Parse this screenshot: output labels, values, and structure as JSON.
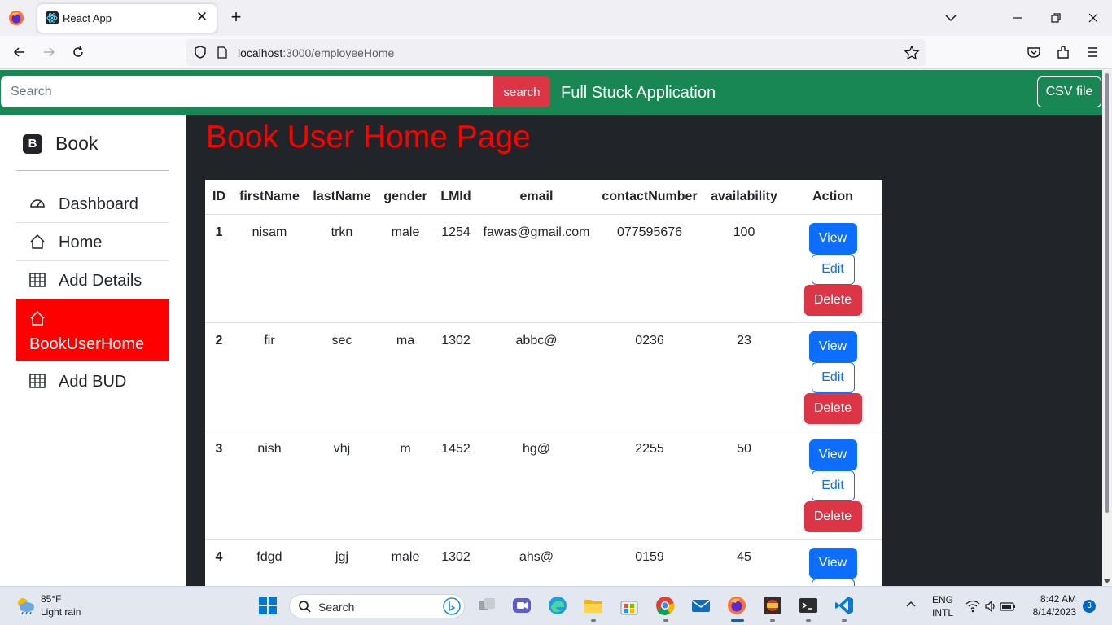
{
  "browser": {
    "tab_title": "React App",
    "url_host": "localhost",
    "url_path": ":3000/employeeHome"
  },
  "header": {
    "search_placeholder": "Search",
    "search_button": "search",
    "brand": "Full Stuck Application",
    "csv_button": "CSV file"
  },
  "sidebar": {
    "brand_letter": "B",
    "brand": "Book",
    "items": [
      {
        "label": "Dashboard",
        "icon": "speedometer-icon"
      },
      {
        "label": "Home",
        "icon": "house-icon"
      },
      {
        "label": "Add Details",
        "icon": "table-icon"
      },
      {
        "label": "BookUserHome",
        "icon": "house-icon",
        "active": true
      },
      {
        "label": "Add BUD",
        "icon": "table-icon"
      }
    ]
  },
  "main": {
    "title": "Book User Home Page",
    "columns": [
      "ID",
      "firstName",
      "lastName",
      "gender",
      "LMId",
      "email",
      "contactNumber",
      "availability",
      "Action"
    ],
    "rows": [
      {
        "id": "1",
        "firstName": "nisam",
        "lastName": "trkn",
        "gender": "male",
        "LMId": "1254",
        "email": "fawas@gmail.com",
        "contactNumber": "077595676",
        "availability": "100"
      },
      {
        "id": "2",
        "firstName": "fir",
        "lastName": "sec",
        "gender": "ma",
        "LMId": "1302",
        "email": "abbc@",
        "contactNumber": "0236",
        "availability": "23"
      },
      {
        "id": "3",
        "firstName": "nish",
        "lastName": "vhj",
        "gender": "m",
        "LMId": "1452",
        "email": "hg@",
        "contactNumber": "2255",
        "availability": "50"
      },
      {
        "id": "4",
        "firstName": "fdgd",
        "lastName": "jgj",
        "gender": "male",
        "LMId": "1302",
        "email": "ahs@",
        "contactNumber": "0159",
        "availability": "45"
      }
    ],
    "actions": {
      "view": "View",
      "edit": "Edit",
      "delete": "Delete"
    }
  },
  "taskbar": {
    "weather_temp": "85°F",
    "weather_desc": "Light rain",
    "search_label": "Search",
    "lang_line1": "ENG",
    "lang_line2": "INTL",
    "time": "8:42 AM",
    "date": "8/14/2023",
    "notification_count": "3"
  },
  "colors": {
    "header_green": "#198754",
    "sidebar_active": "#ff0000",
    "title_red": "#ff0000",
    "main_bg": "#212529",
    "view_blue": "#0d6efd",
    "delete_red": "#dc3545"
  }
}
